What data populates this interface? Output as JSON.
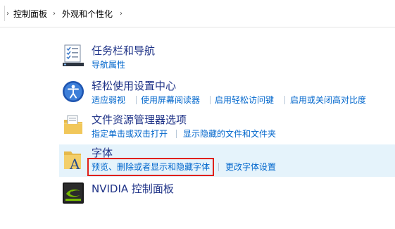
{
  "breadcrumb": {
    "items": [
      "控制面板",
      "外观和个性化"
    ],
    "separator": "›"
  },
  "items": [
    {
      "title": "任务栏和导航",
      "links": [
        "导航属性"
      ]
    },
    {
      "title": "轻松使用设置中心",
      "links": [
        "适应弱视",
        "使用屏幕阅读器",
        "启用轻松访问键",
        "启用或关闭高对比度"
      ]
    },
    {
      "title": "文件资源管理器选项",
      "links": [
        "指定单击或双击打开",
        "显示隐藏的文件和文件夹"
      ]
    },
    {
      "title": "字体",
      "links": [
        "预览、删除或者显示和隐藏字体",
        "更改字体设置"
      ]
    },
    {
      "title": "NVIDIA 控制面板",
      "links": []
    }
  ],
  "colors": {
    "title": "#1e3287",
    "link": "#0066cc",
    "selected_bg": "#e5f3fb",
    "highlight_border": "#e0201a"
  }
}
